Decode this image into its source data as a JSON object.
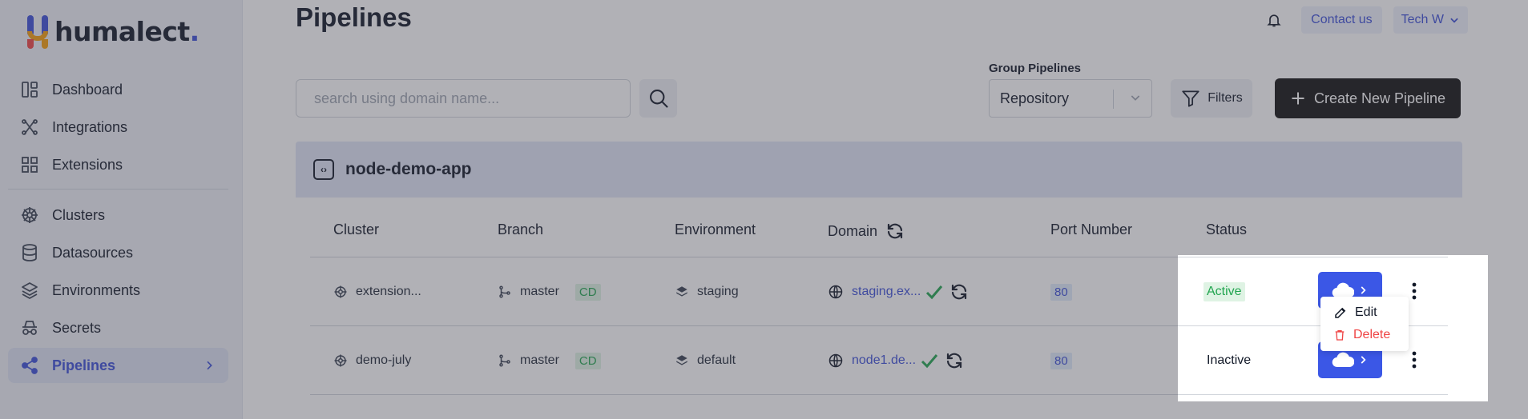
{
  "brand": {
    "name": "humalect",
    "dot": "."
  },
  "sidebar": {
    "items": [
      {
        "label": "Dashboard",
        "icon": "dashboard-icon"
      },
      {
        "label": "Integrations",
        "icon": "integrations-icon"
      },
      {
        "label": "Extensions",
        "icon": "extensions-icon"
      },
      {
        "label": "Clusters",
        "icon": "helm-icon"
      },
      {
        "label": "Datasources",
        "icon": "database-icon"
      },
      {
        "label": "Environments",
        "icon": "layers-icon"
      },
      {
        "label": "Secrets",
        "icon": "spy-icon"
      },
      {
        "label": "Pipelines",
        "icon": "share-icon",
        "active": true
      }
    ]
  },
  "header": {
    "title": "Pipelines",
    "contact": "Contact us",
    "user": "Tech W"
  },
  "toolbar": {
    "search_placeholder": "search using domain name...",
    "group_label": "Group Pipelines",
    "group_value": "Repository",
    "filters_label": "Filters",
    "create_label": "Create New Pipeline"
  },
  "group": {
    "name": "node-demo-app"
  },
  "table": {
    "columns": [
      "Cluster",
      "Branch",
      "Environment",
      "Domain",
      "Port Number",
      "Status"
    ],
    "rows": [
      {
        "cluster": "extension...",
        "branch": "master",
        "tag": "CD",
        "environment": "staging",
        "domain": "staging.ex...",
        "port": "80",
        "status": "Active"
      },
      {
        "cluster": "demo-july",
        "branch": "master",
        "tag": "CD",
        "environment": "default",
        "domain": "node1.de...",
        "port": "80",
        "status": "Inactive"
      }
    ]
  },
  "menu": {
    "edit": "Edit",
    "delete": "Delete"
  },
  "colors": {
    "accent": "#3b4fd8",
    "active_green": "#22a550",
    "danger": "#ef4444"
  }
}
